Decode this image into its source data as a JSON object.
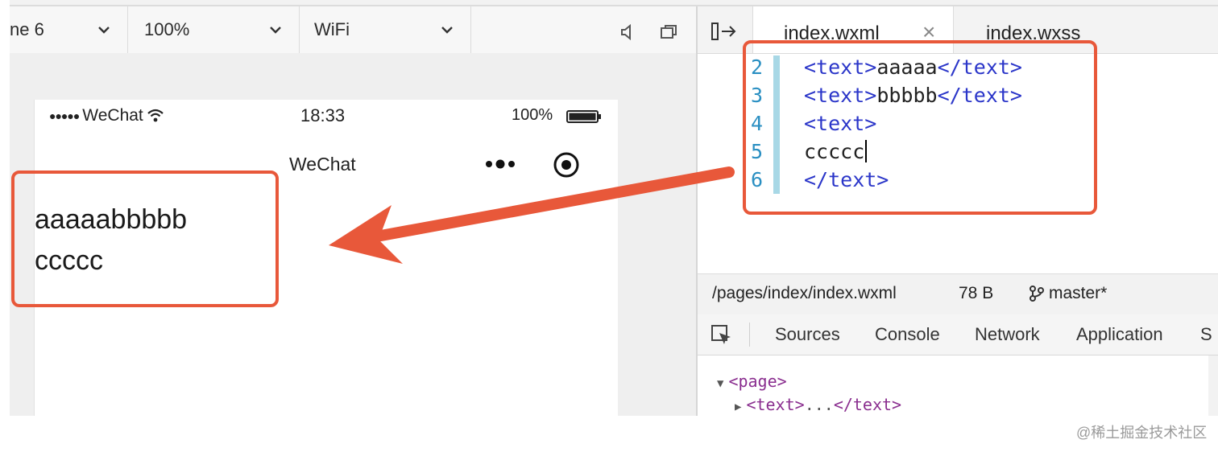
{
  "toolbar": {
    "device": "ne 6",
    "zoom": "100%",
    "network": "WiFi",
    "icons": [
      "chevron-down-icon",
      "speaker-icon",
      "window-icon"
    ]
  },
  "phone": {
    "carrier_dots": "●●●●●",
    "carrier": "WeChat",
    "time": "18:33",
    "battery": "100%",
    "nav_title": "WeChat",
    "output_line1": "aaaaabbbbb",
    "output_line2": "ccccc"
  },
  "editor": {
    "tabs": [
      {
        "label": "index.wxml",
        "active": true
      },
      {
        "label": "index.wxss",
        "active": false
      }
    ],
    "close_glyph": "×",
    "lines": [
      {
        "num": "2",
        "open": "<text>",
        "content": "aaaaa",
        "close": "</text>"
      },
      {
        "num": "3",
        "open": "<text>",
        "content": "bbbbb",
        "close": "</text>"
      },
      {
        "num": "4",
        "open": "<text>",
        "content": "",
        "close": ""
      },
      {
        "num": "5",
        "open": "",
        "content": "ccccc",
        "close": ""
      },
      {
        "num": "6",
        "open": "",
        "content": "",
        "close": "</text>"
      }
    ]
  },
  "file_status": {
    "path": "/pages/index/index.wxml",
    "size": "78 B",
    "branch": "master*"
  },
  "devtools": {
    "tabs": [
      "Sources",
      "Console",
      "Network",
      "Application",
      "S"
    ],
    "dom_line1": "<page>",
    "dom_line2_open": "<text>",
    "dom_line2_dots": "...",
    "dom_line2_close": "</text>"
  },
  "annotation_color": "#e8583a",
  "watermark": "@稀土掘金技术社区"
}
